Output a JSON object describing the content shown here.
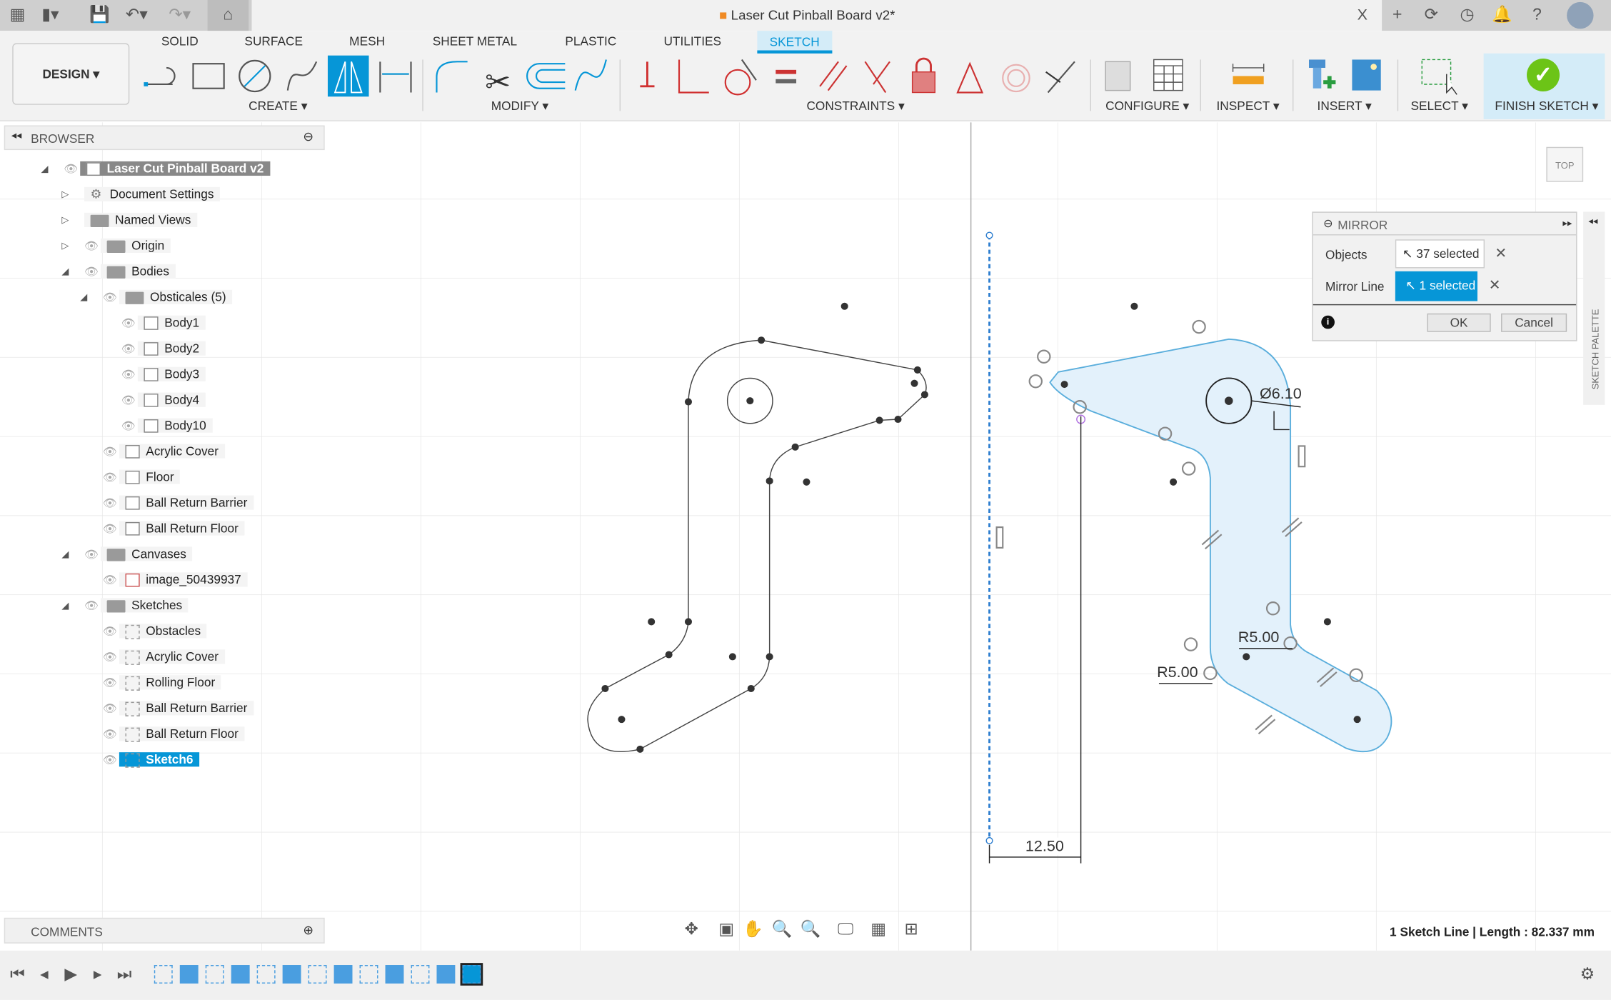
{
  "window": {
    "title": "Laser Cut Pinball Board v2*",
    "close": "X"
  },
  "ribbon": {
    "workspace": "DESIGN ▾",
    "tabs": [
      "SOLID",
      "SURFACE",
      "MESH",
      "SHEET METAL",
      "PLASTIC",
      "UTILITIES",
      "SKETCH"
    ],
    "active_tab": "SKETCH",
    "groups": [
      "CREATE ▾",
      "MODIFY ▾",
      "CONSTRAINTS ▾",
      "CONFIGURE ▾",
      "INSPECT ▾",
      "INSERT ▾",
      "SELECT ▾",
      "FINISH SKETCH ▾"
    ]
  },
  "browser": {
    "title": "BROWSER",
    "items": [
      {
        "label": "Laser Cut Pinball Board v2",
        "level": 0,
        "type": "root",
        "exp": "open"
      },
      {
        "label": "Document Settings",
        "level": 1,
        "type": "gear",
        "exp": "closed"
      },
      {
        "label": "Named Views",
        "level": 1,
        "type": "folder",
        "exp": "closed"
      },
      {
        "label": "Origin",
        "level": 1,
        "type": "folder",
        "exp": "closed"
      },
      {
        "label": "Bodies",
        "level": 1,
        "type": "folder",
        "exp": "open"
      },
      {
        "label": "Obsticales (5)",
        "level": 2,
        "type": "folder",
        "exp": "open"
      },
      {
        "label": "Body1",
        "level": 3,
        "type": "body"
      },
      {
        "label": "Body2",
        "level": 3,
        "type": "body"
      },
      {
        "label": "Body3",
        "level": 3,
        "type": "body"
      },
      {
        "label": "Body4",
        "level": 3,
        "type": "body"
      },
      {
        "label": "Body10",
        "level": 3,
        "type": "body"
      },
      {
        "label": "Acrylic Cover",
        "level": 2,
        "type": "body"
      },
      {
        "label": "Floor",
        "level": 2,
        "type": "body"
      },
      {
        "label": "Ball Return Barrier",
        "level": 2,
        "type": "body"
      },
      {
        "label": "Ball Return Floor",
        "level": 2,
        "type": "body"
      },
      {
        "label": "Canvases",
        "level": 1,
        "type": "folder",
        "exp": "open"
      },
      {
        "label": "image_50439937",
        "level": 2,
        "type": "image"
      },
      {
        "label": "Sketches",
        "level": 1,
        "type": "folder",
        "exp": "open"
      },
      {
        "label": "Obstacles",
        "level": 2,
        "type": "sketch"
      },
      {
        "label": "Acrylic Cover",
        "level": 2,
        "type": "sketch"
      },
      {
        "label": "Rolling Floor",
        "level": 2,
        "type": "sketch"
      },
      {
        "label": "Ball Return Barrier",
        "level": 2,
        "type": "sketch"
      },
      {
        "label": "Ball Return Floor",
        "level": 2,
        "type": "sketch"
      },
      {
        "label": "Sketch6",
        "level": 2,
        "type": "sketch",
        "selected": true
      }
    ]
  },
  "mirror_dialog": {
    "title": "MIRROR",
    "objects_label": "Objects",
    "objects_value": "37 selected",
    "mirror_line_label": "Mirror Line",
    "mirror_line_value": "1 selected",
    "ok": "OK",
    "cancel": "Cancel"
  },
  "canvas": {
    "dimensions": {
      "diameter": "Ø6.10",
      "radius1": "R5.00",
      "radius2": "R5.00",
      "offset": "12.50"
    },
    "viewcube": "TOP",
    "sketch_palette": "SKETCH PALETTE"
  },
  "comments": {
    "title": "COMMENTS"
  },
  "status": {
    "text": "1 Sketch Line | Length : 82.337 mm"
  },
  "colors": {
    "accent": "#0696d7",
    "finish": "#6cc417",
    "fill": "#e3f1fb",
    "sketch_line": "#5aaedc"
  }
}
